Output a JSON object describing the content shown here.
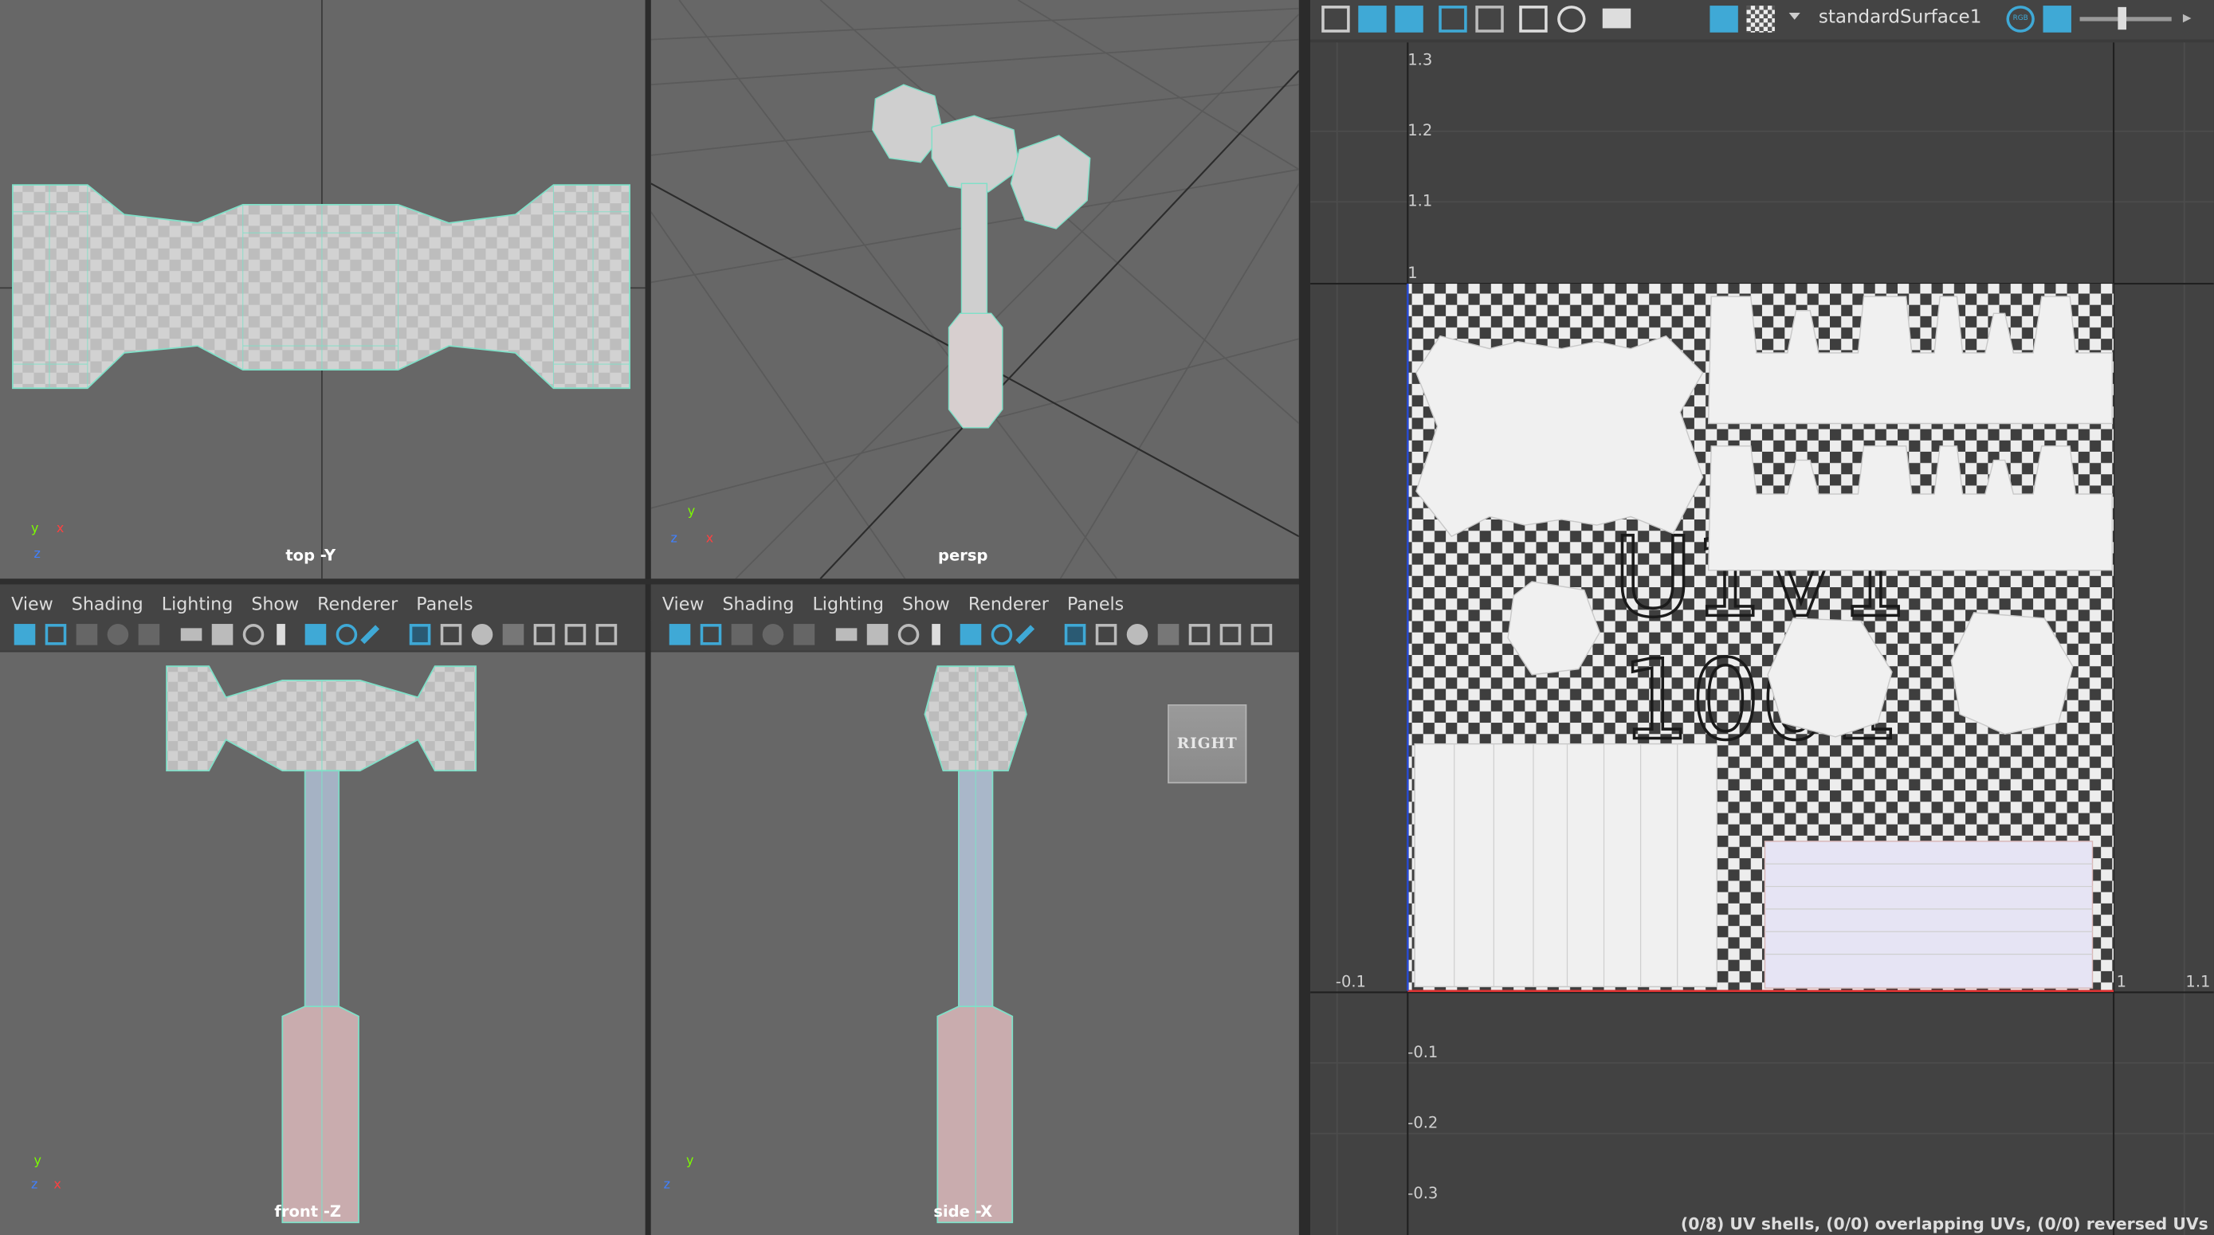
{
  "viewports": {
    "top_label": "top -Y",
    "persp_label": "persp",
    "front_label": "front -Z",
    "side_label": "side -X",
    "view_cube_label": "RIGHT"
  },
  "panel_menu": [
    "View",
    "Shading",
    "Lighting",
    "Show",
    "Renderer",
    "Panels"
  ],
  "axes": {
    "x": "x",
    "y": "y",
    "z": "z"
  },
  "uv_editor": {
    "material": "standardSurface1",
    "rgb_label": "RGB",
    "v_ticks": [
      "1.3",
      "1.2",
      "1.1",
      "1",
      "-0.1",
      "-0.2",
      "-0.3"
    ],
    "u_ticks": [
      "-0.1",
      "1",
      "1.1"
    ],
    "tile_label_line1": "U1V1",
    "tile_label_line2": "1001",
    "status": "(0/8) UV shells, (0/0) overlapping UVs, (0/0) reversed UVs"
  },
  "colors": {
    "viewport_bg": "#676767",
    "wire": "#7fe0c8",
    "accent_blue": "#3fa9d6"
  }
}
